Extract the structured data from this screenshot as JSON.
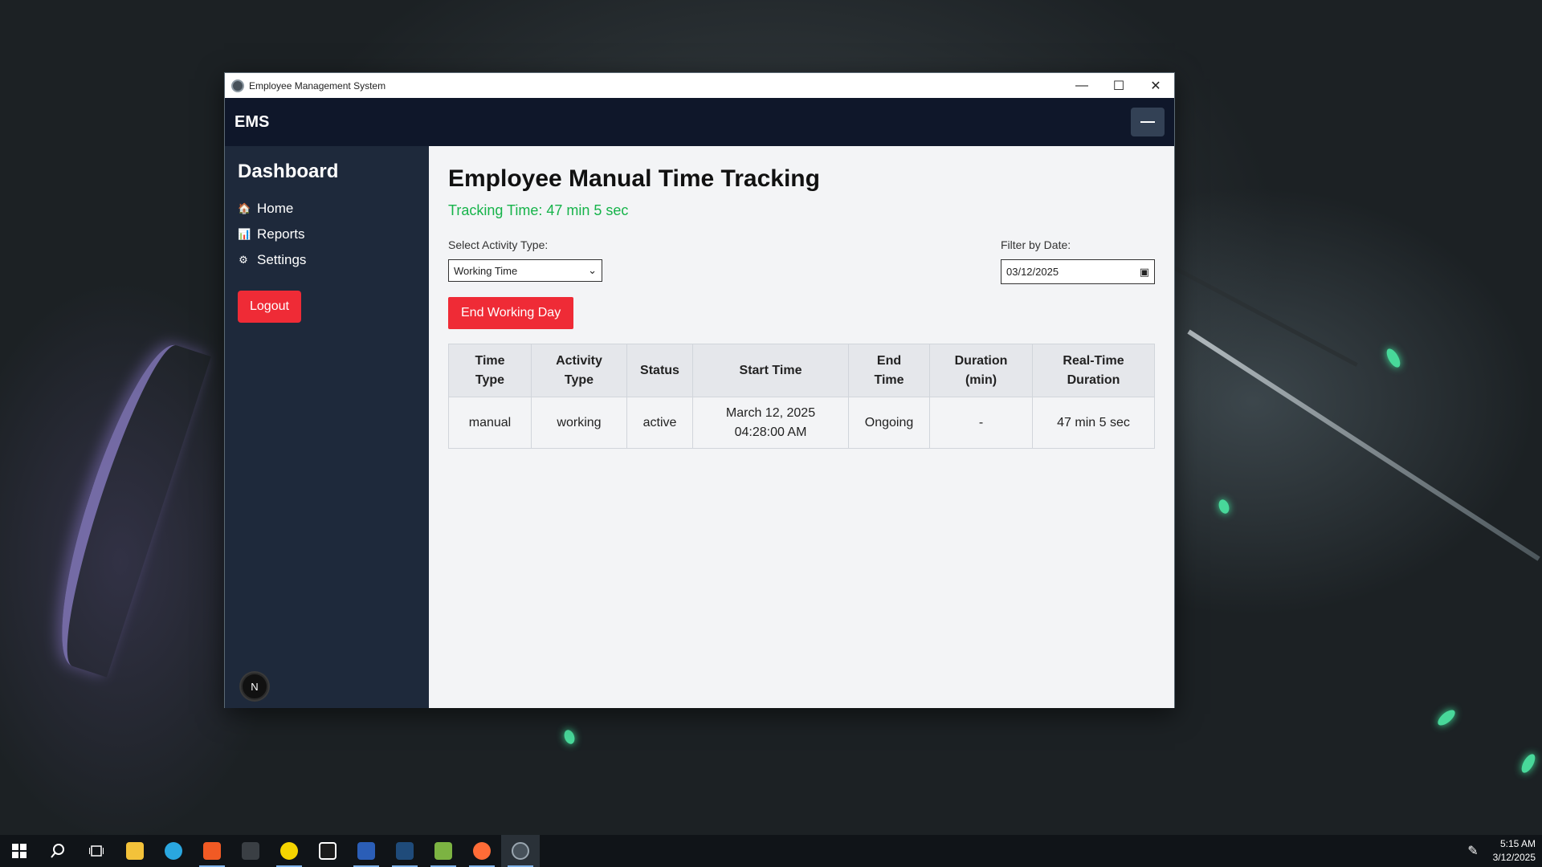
{
  "window": {
    "title": "Employee Management System",
    "controls": {
      "minimize": "—",
      "maximize": "☐",
      "close": "✕"
    }
  },
  "topnav": {
    "brand": "EMS",
    "menu_icon": "hamburger-icon"
  },
  "sidebar": {
    "heading": "Dashboard",
    "items": [
      {
        "label": "Home",
        "icon": "home-icon",
        "glyph": "🏠"
      },
      {
        "label": "Reports",
        "icon": "chart-icon",
        "glyph": "📊"
      },
      {
        "label": "Settings",
        "icon": "gear-icon",
        "glyph": "⚙"
      }
    ],
    "logout_label": "Logout",
    "badge": "N"
  },
  "main": {
    "title": "Employee Manual Time Tracking",
    "tracking_time": "Tracking Time: 47 min 5 sec",
    "activity_label": "Select Activity Type:",
    "activity_value": "Working Time",
    "date_label": "Filter by Date:",
    "date_value": "03/12/2025",
    "end_button": "End Working Day",
    "table": {
      "headers": [
        "Time Type",
        "Activity Type",
        "Status",
        "Start Time",
        "End Time",
        "Duration (min)",
        "Real-Time Duration"
      ],
      "header_lines": [
        [
          "Time",
          "Type"
        ],
        [
          "Activity",
          "Type"
        ],
        [
          "Status"
        ],
        [
          "Start Time"
        ],
        [
          "End",
          "Time"
        ],
        [
          "Duration",
          "(min)"
        ],
        [
          "Real-Time",
          "Duration"
        ]
      ],
      "rows": [
        {
          "time_type": "manual",
          "activity_type": "working",
          "status": "active",
          "start_date": "March 12, 2025",
          "start_time": "04:28:00 AM",
          "end_time": "Ongoing",
          "duration": "-",
          "realtime": "47 min 5 sec"
        }
      ]
    }
  },
  "taskbar": {
    "time": "5:15 AM",
    "date": "3/12/2025"
  },
  "colors": {
    "nav_bg": "#0f172a",
    "sidebar_bg": "#1e293b",
    "accent_red": "#ef2b36",
    "tracking_green": "#16b34a"
  }
}
